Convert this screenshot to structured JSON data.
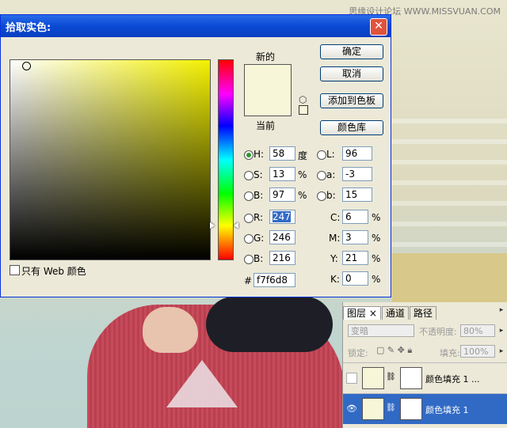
{
  "watermark": "思缘设计论坛 WWW.MISSVUAN.COM",
  "dialog": {
    "title": "拾取实色:",
    "close_label": "✕",
    "new_label": "新的",
    "current_label": "当前",
    "web_only_label": "只有 Web 颜色",
    "buttons": {
      "ok": "确定",
      "cancel": "取消",
      "add_swatch": "添加到色板",
      "color_lib": "颜色库"
    },
    "colors": {
      "new": "#f7f6d8",
      "current": "#f7f6d8",
      "hue_base": "#f3f000"
    },
    "hsb": {
      "h": "58",
      "h_unit": "度",
      "s": "13",
      "s_unit": "%",
      "b": "97",
      "b_unit": "%"
    },
    "rgb": {
      "r": "247",
      "g": "246",
      "b": "216"
    },
    "lab": {
      "l": "96",
      "a": "-3",
      "b": "15"
    },
    "cmyk": {
      "c": "6",
      "m": "3",
      "y": "21",
      "k": "0",
      "unit": "%"
    },
    "labels": {
      "h": "H:",
      "s": "S:",
      "b": "B:",
      "r": "R:",
      "g": "G:",
      "bb": "B:",
      "l": "L:",
      "a": "a:",
      "lb": "b:",
      "c": "C:",
      "m": "M:",
      "y": "Y:",
      "k": "K:",
      "hash": "#"
    },
    "hex": "f7f6d8"
  },
  "layers_panel": {
    "tabs": [
      "图层",
      "通道",
      "路径"
    ],
    "tab_close": "×",
    "blend_mode": "变暗",
    "opacity_label": "不透明度:",
    "opacity_value": "80%",
    "lock_label": "锁定:",
    "fill_label": "填充:",
    "fill_value": "100%",
    "layers": [
      {
        "name": "颜色填充 1 ...",
        "selected": false
      },
      {
        "name": "颜色填充 1",
        "selected": true
      }
    ]
  }
}
